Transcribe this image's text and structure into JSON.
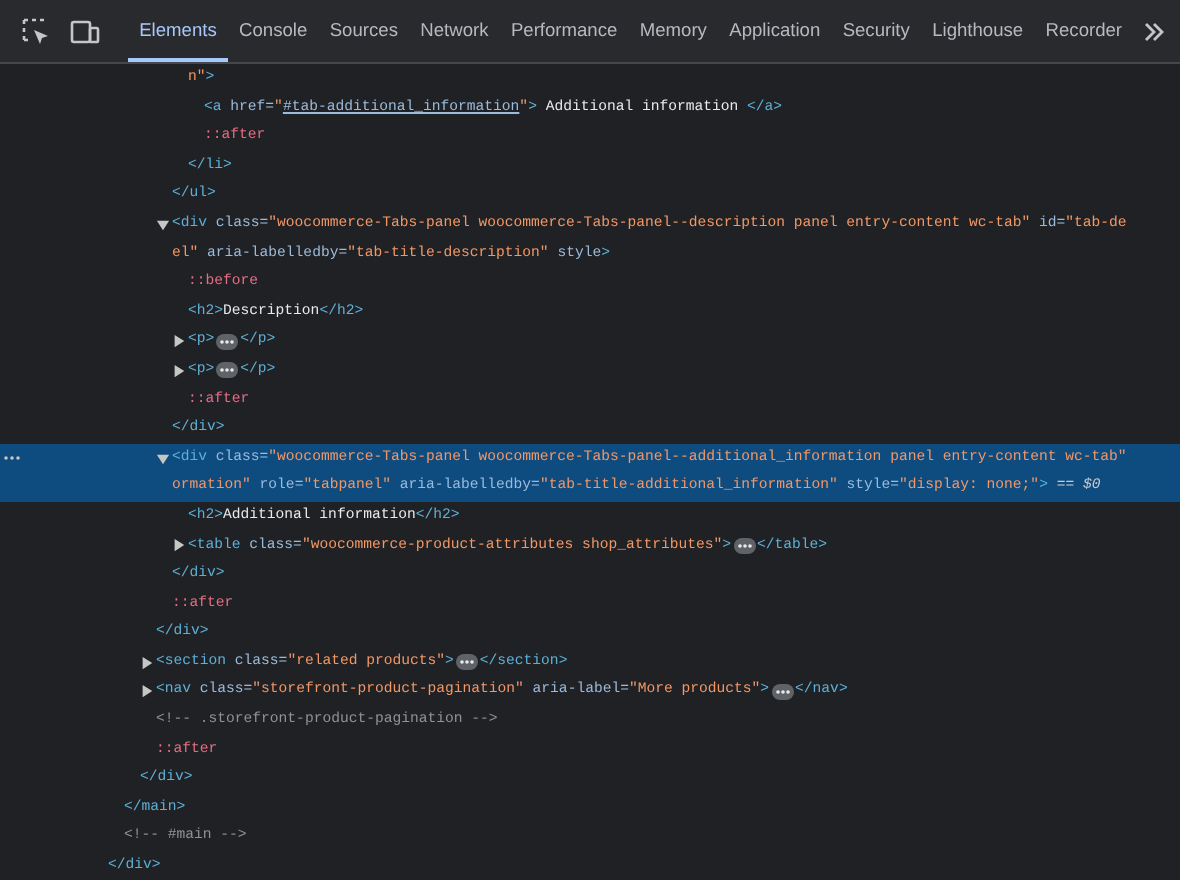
{
  "toolbar": {
    "tabs": [
      {
        "label": "Elements",
        "selected": true
      },
      {
        "label": "Console",
        "selected": false
      },
      {
        "label": "Sources",
        "selected": false
      },
      {
        "label": "Network",
        "selected": false
      },
      {
        "label": "Performance",
        "selected": false
      },
      {
        "label": "Memory",
        "selected": false
      },
      {
        "label": "Application",
        "selected": false
      },
      {
        "label": "Security",
        "selected": false
      },
      {
        "label": "Lighthouse",
        "selected": false
      },
      {
        "label": "Recorder",
        "selected": false
      }
    ]
  },
  "dom_tree": [
    {
      "children": [
        {
          "children": [
            {
              "children": [
                {
                  "children": [
                    {
                      "children": [
                        {
                          "children": [
                            {
                              "selected": false,
                              "lines": [
                                [
                                  {
                                    "kind": "value",
                                    "text": "n\""
                                  },
                                  {
                                    "kind": "tag",
                                    "text": ">"
                                  }
                                ]
                              ],
                              "children": [
                                {
                                  "selected": false,
                                  "lines": [
                                    [
                                      {
                                        "kind": "tag",
                                        "text": "<a"
                                      },
                                      {
                                        "kind": "attr",
                                        "text": " href="
                                      },
                                      {
                                        "kind": "value",
                                        "text": "\""
                                      },
                                      {
                                        "kind": "link",
                                        "text": "#tab-additional_information"
                                      },
                                      {
                                        "kind": "value",
                                        "text": "\""
                                      },
                                      {
                                        "kind": "tag",
                                        "text": ">"
                                      },
                                      {
                                        "kind": "text",
                                        "text": " Additional information "
                                      },
                                      {
                                        "kind": "tag",
                                        "text": "</a>"
                                      }
                                    ]
                                  ]
                                },
                                {
                                  "selected": false,
                                  "lines": [
                                    [
                                      {
                                        "kind": "pseudo",
                                        "text": "::after"
                                      }
                                    ]
                                  ]
                                }
                              ]
                            },
                            {
                              "selected": false,
                              "lines": [
                                [
                                  {
                                    "kind": "tag",
                                    "text": "</li>"
                                  }
                                ]
                              ]
                            }
                          ]
                        },
                        {
                          "selected": false,
                          "lines": [
                            [
                              {
                                "kind": "tag",
                                "text": "</ul>"
                              }
                            ]
                          ]
                        },
                        {
                          "selected": false,
                          "expanded": true,
                          "lines": [
                            [
                              {
                                "kind": "tag",
                                "text": "<div"
                              },
                              {
                                "kind": "attr",
                                "text": " class="
                              },
                              {
                                "kind": "value",
                                "text": "\"woocommerce-Tabs-panel woocommerce-Tabs-panel--description panel entry-content wc-tab\""
                              },
                              {
                                "kind": "attr",
                                "text": " id="
                              },
                              {
                                "kind": "value",
                                "text": "\"tab-de"
                              }
                            ],
                            [
                              {
                                "kind": "value",
                                "text": "el\""
                              },
                              {
                                "kind": "attr",
                                "text": " aria-labelledby="
                              },
                              {
                                "kind": "value",
                                "text": "\"tab-title-description\""
                              },
                              {
                                "kind": "attr",
                                "text": " style"
                              },
                              {
                                "kind": "tag",
                                "text": ">"
                              }
                            ]
                          ],
                          "children": [
                            {
                              "selected": false,
                              "lines": [
                                [
                                  {
                                    "kind": "pseudo",
                                    "text": "::before"
                                  }
                                ]
                              ]
                            },
                            {
                              "selected": false,
                              "lines": [
                                [
                                  {
                                    "kind": "tag",
                                    "text": "<h2>"
                                  },
                                  {
                                    "kind": "text",
                                    "text": "Description"
                                  },
                                  {
                                    "kind": "tag",
                                    "text": "</h2>"
                                  }
                                ]
                              ]
                            },
                            {
                              "selected": false,
                              "expanded": false,
                              "lines": [
                                [
                                  {
                                    "kind": "tag",
                                    "text": "<p>"
                                  },
                                  {
                                    "kind": "ellipsis"
                                  },
                                  {
                                    "kind": "tag",
                                    "text": "</p>"
                                  }
                                ]
                              ]
                            },
                            {
                              "selected": false,
                              "expanded": false,
                              "lines": [
                                [
                                  {
                                    "kind": "tag",
                                    "text": "<p>"
                                  },
                                  {
                                    "kind": "ellipsis"
                                  },
                                  {
                                    "kind": "tag",
                                    "text": "</p>"
                                  }
                                ]
                              ]
                            },
                            {
                              "selected": false,
                              "lines": [
                                [
                                  {
                                    "kind": "pseudo",
                                    "text": "::after"
                                  }
                                ]
                              ]
                            }
                          ]
                        },
                        {
                          "selected": false,
                          "lines": [
                            [
                              {
                                "kind": "tag",
                                "text": "</div>"
                              }
                            ]
                          ]
                        },
                        {
                          "selected": true,
                          "expanded": true,
                          "lines": [
                            [
                              {
                                "kind": "tag",
                                "text": "<div"
                              },
                              {
                                "kind": "attr",
                                "text": " class="
                              },
                              {
                                "kind": "value",
                                "text": "\"woocommerce-Tabs-panel woocommerce-Tabs-panel--additional_information panel entry-content wc-tab\""
                              }
                            ],
                            [
                              {
                                "kind": "value",
                                "text": "ormation\""
                              },
                              {
                                "kind": "attr",
                                "text": " role="
                              },
                              {
                                "kind": "value",
                                "text": "\"tabpanel\""
                              },
                              {
                                "kind": "attr",
                                "text": " aria-labelledby="
                              },
                              {
                                "kind": "value",
                                "text": "\"tab-title-additional_information\""
                              },
                              {
                                "kind": "attr",
                                "text": " style="
                              },
                              {
                                "kind": "value",
                                "text": "\"display: none;\""
                              },
                              {
                                "kind": "tag",
                                "text": ">"
                              },
                              {
                                "kind": "ref",
                                "text": " == $0"
                              }
                            ]
                          ],
                          "children": [
                            {
                              "selected": false,
                              "lines": [
                                [
                                  {
                                    "kind": "tag",
                                    "text": "<h2>"
                                  },
                                  {
                                    "kind": "text",
                                    "text": "Additional information"
                                  },
                                  {
                                    "kind": "tag",
                                    "text": "</h2>"
                                  }
                                ]
                              ]
                            },
                            {
                              "selected": false,
                              "expanded": false,
                              "lines": [
                                [
                                  {
                                    "kind": "tag",
                                    "text": "<table"
                                  },
                                  {
                                    "kind": "attr",
                                    "text": " class="
                                  },
                                  {
                                    "kind": "value",
                                    "text": "\"woocommerce-product-attributes shop_attributes\""
                                  },
                                  {
                                    "kind": "tag",
                                    "text": ">"
                                  },
                                  {
                                    "kind": "ellipsis"
                                  },
                                  {
                                    "kind": "tag",
                                    "text": "</table>"
                                  }
                                ]
                              ]
                            }
                          ]
                        },
                        {
                          "selected": false,
                          "lines": [
                            [
                              {
                                "kind": "tag",
                                "text": "</div>"
                              }
                            ]
                          ]
                        },
                        {
                          "selected": false,
                          "lines": [
                            [
                              {
                                "kind": "pseudo",
                                "text": "::after"
                              }
                            ]
                          ]
                        }
                      ]
                    },
                    {
                      "selected": false,
                      "lines": [
                        [
                          {
                            "kind": "tag",
                            "text": "</div>"
                          }
                        ]
                      ]
                    },
                    {
                      "selected": false,
                      "expanded": false,
                      "lines": [
                        [
                          {
                            "kind": "tag",
                            "text": "<section"
                          },
                          {
                            "kind": "attr",
                            "text": " class="
                          },
                          {
                            "kind": "value",
                            "text": "\"related products\""
                          },
                          {
                            "kind": "tag",
                            "text": ">"
                          },
                          {
                            "kind": "ellipsis"
                          },
                          {
                            "kind": "tag",
                            "text": "</section>"
                          }
                        ]
                      ]
                    },
                    {
                      "selected": false,
                      "expanded": false,
                      "lines": [
                        [
                          {
                            "kind": "tag",
                            "text": "<nav"
                          },
                          {
                            "kind": "attr",
                            "text": " class="
                          },
                          {
                            "kind": "value",
                            "text": "\"storefront-product-pagination\""
                          },
                          {
                            "kind": "attr",
                            "text": " aria-label="
                          },
                          {
                            "kind": "value",
                            "text": "\"More products\""
                          },
                          {
                            "kind": "tag",
                            "text": ">"
                          },
                          {
                            "kind": "ellipsis"
                          },
                          {
                            "kind": "tag",
                            "text": "</nav>"
                          }
                        ]
                      ]
                    },
                    {
                      "selected": false,
                      "lines": [
                        [
                          {
                            "kind": "comment",
                            "text": "<!-- .storefront-product-pagination -->"
                          }
                        ]
                      ]
                    },
                    {
                      "selected": false,
                      "lines": [
                        [
                          {
                            "kind": "pseudo",
                            "text": "::after"
                          }
                        ]
                      ]
                    }
                  ]
                },
                {
                  "selected": false,
                  "lines": [
                    [
                      {
                        "kind": "tag",
                        "text": "</div>"
                      }
                    ]
                  ]
                }
              ]
            },
            {
              "selected": false,
              "lines": [
                [
                  {
                    "kind": "tag",
                    "text": "</main>"
                  }
                ]
              ]
            },
            {
              "selected": false,
              "lines": [
                [
                  {
                    "kind": "comment",
                    "text": "<!-- #main -->"
                  }
                ]
              ]
            }
          ]
        },
        {
          "selected": false,
          "lines": [
            [
              {
                "kind": "tag",
                "text": "</div>"
              }
            ]
          ]
        }
      ]
    }
  ]
}
